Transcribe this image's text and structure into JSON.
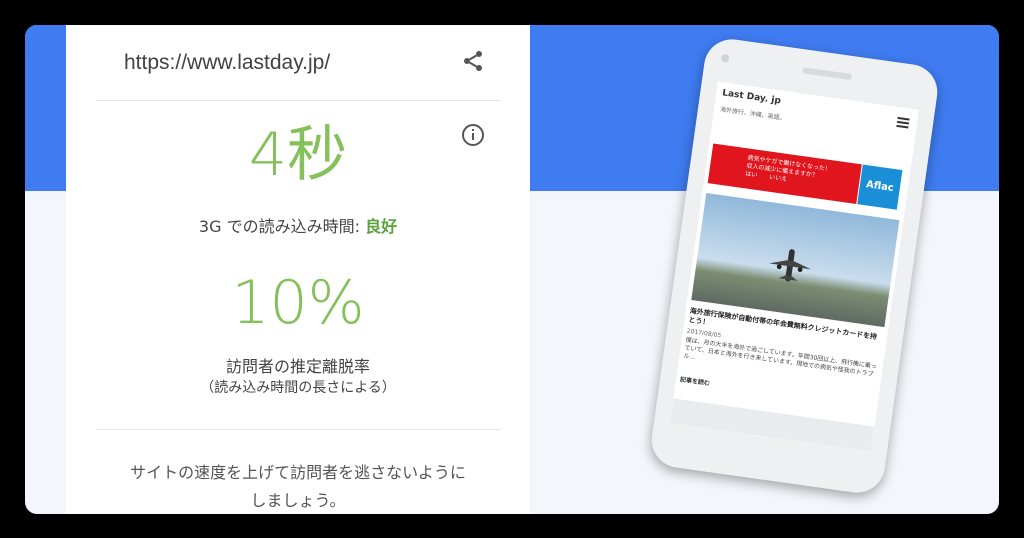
{
  "card": {
    "url": "https://www.lastday.jp/",
    "load_time": "4秒",
    "load_label": "3G での読み込み時間:",
    "load_rating": "良好",
    "bounce": "10%",
    "bounce_label": "訪問者の推定離脱率",
    "bounce_note": "（読み込み時間の長さによる）",
    "tip_line1": "サイトの速度を上げて訪問者を逃さないように",
    "tip_line2": "しましょう。"
  },
  "phone": {
    "site_title": "Last Day. jp",
    "site_subtitle": "海外旅行、沖縄、英語。",
    "ad_text_1": "病気やケガで働けなくなった！",
    "ad_text_2": "収入の減少に備えますか？",
    "ad_text_3": "はい　　いいえ",
    "ad_brand": "Aflac",
    "article_headline": "海外旅行保険が自動付帯の年会費無料クレジットカードを持とう！",
    "article_date": "2017/08/05",
    "article_body": "僕は、月の大半を海外で過ごしています。年間30回以上、飛行機に乗っていて、日本と海外を行き来しています。現地での病気や怪我のトラブル…",
    "article_more": "記事を読む"
  },
  "colors": {
    "accent_blue": "#3f7cf1",
    "good_green": "#86c05a"
  }
}
